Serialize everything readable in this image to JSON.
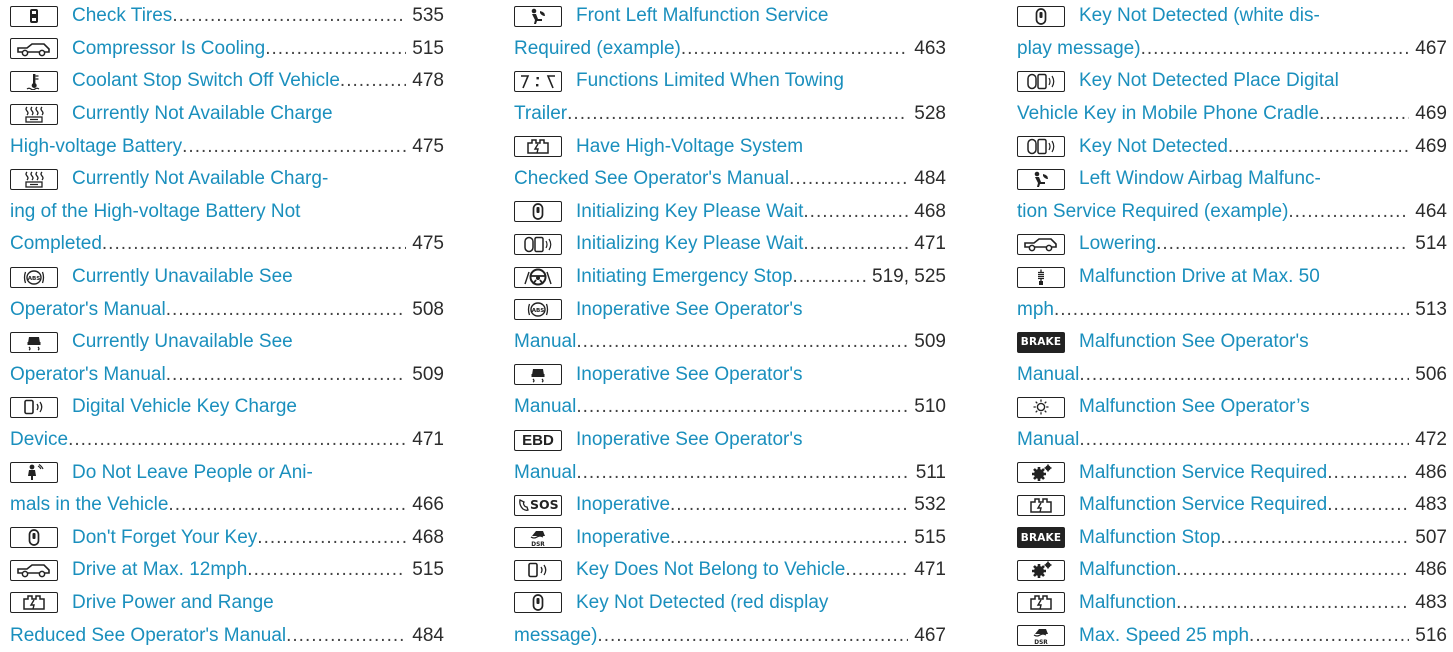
{
  "columns": [
    {
      "entries": [
        {
          "icon": "tire-pressure-icon",
          "lines": [
            "Check Tires"
          ],
          "page": "535"
        },
        {
          "icon": "car-level-icon",
          "lines": [
            "Compressor Is Cooling"
          ],
          "page": "515"
        },
        {
          "icon": "coolant-temperature-icon",
          "lines": [
            "Coolant Stop Switch Off Vehicle"
          ],
          "page": "478"
        },
        {
          "icon": "battery-heat-icon",
          "lines": [
            "Currently Not Available Charge",
            "High-voltage Battery"
          ],
          "page": "475"
        },
        {
          "icon": "battery-heat-icon",
          "lines": [
            "Currently Not Available Charg-",
            "ing of the High-voltage Battery Not",
            "Completed"
          ],
          "page": "475"
        },
        {
          "icon": "abs-icon",
          "icon_text": "ABS",
          "lines": [
            "Currently Unavailable See",
            "Operator's Manual"
          ],
          "page": "508"
        },
        {
          "icon": "skid-car-icon",
          "lines": [
            "Currently Unavailable See",
            "Operator's Manual"
          ],
          "page": "509"
        },
        {
          "icon": "phone-key-icon",
          "lines": [
            "Digital Vehicle Key Charge",
            "Device"
          ],
          "page": "471"
        },
        {
          "icon": "person-in-car-icon",
          "lines": [
            "Do Not Leave People or Ani-",
            "mals in the Vehicle"
          ],
          "page": "466"
        },
        {
          "icon": "key-fob-icon",
          "lines": [
            "Don't Forget Your Key"
          ],
          "page": "468"
        },
        {
          "icon": "car-level-icon",
          "lines": [
            "Drive at Max. 12mph"
          ],
          "page": "515"
        },
        {
          "icon": "hv-battery-icon",
          "lines": [
            "Drive Power and Range",
            "Reduced See Operator's Manual"
          ],
          "page": "484"
        }
      ]
    },
    {
      "entries": [
        {
          "icon": "airbag-icon",
          "lines": [
            "Front Left Malfunction Service",
            "Required (example)"
          ],
          "page": "463"
        },
        {
          "icon": "towing-lanes-icon",
          "lines": [
            "Functions Limited When Towing",
            "Trailer"
          ],
          "page": "528"
        },
        {
          "icon": "hv-battery-icon",
          "lines": [
            "Have High-Voltage System",
            "Checked See Operator's Manual"
          ],
          "page": "484"
        },
        {
          "icon": "key-fob-icon",
          "lines": [
            "Initializing Key Please Wait"
          ],
          "page": "468"
        },
        {
          "icon": "digital-key-icon",
          "lines": [
            "Initializing Key Please Wait"
          ],
          "page": "471"
        },
        {
          "icon": "steering-wheel-icon",
          "lines": [
            "Initiating Emergency Stop"
          ],
          "page": "519, 525"
        },
        {
          "icon": "abs-icon",
          "icon_text": "ABS",
          "lines": [
            "Inoperative See Operator's",
            "Manual"
          ],
          "page": "509"
        },
        {
          "icon": "skid-car-icon",
          "lines": [
            "Inoperative See Operator's",
            "Manual"
          ],
          "page": "510"
        },
        {
          "icon": "ebd-icon",
          "icon_text": "EBD",
          "lines": [
            "Inoperative See Operator's",
            "Manual"
          ],
          "page": "511"
        },
        {
          "icon": "sos-icon",
          "icon_text": "SOS",
          "lines": [
            "Inoperative"
          ],
          "page": "532"
        },
        {
          "icon": "dsr-icon",
          "icon_text": "DSR",
          "lines": [
            "Inoperative"
          ],
          "page": "515"
        },
        {
          "icon": "phone-key-icon",
          "lines": [
            "Key Does Not Belong to Vehicle"
          ],
          "page": "471"
        },
        {
          "icon": "key-fob-icon",
          "lines": [
            "Key Not Detected  (red display",
            "message)"
          ],
          "page": "467"
        }
      ]
    },
    {
      "entries": [
        {
          "icon": "key-fob-icon",
          "lines": [
            "Key Not Detected  (white dis-",
            "play message)"
          ],
          "page": "467"
        },
        {
          "icon": "digital-key-icon",
          "lines": [
            "Key Not Detected Place Digital",
            "Vehicle Key in Mobile Phone Cradle"
          ],
          "page": "469"
        },
        {
          "icon": "digital-key-icon",
          "lines": [
            "Key Not Detected"
          ],
          "page": "469"
        },
        {
          "icon": "airbag-icon",
          "lines": [
            "Left Window Airbag Malfunc-",
            "tion Service Required (example)"
          ],
          "page": "464"
        },
        {
          "icon": "car-level-icon",
          "lines": [
            "Lowering"
          ],
          "page": "514"
        },
        {
          "icon": "shock-absorber-icon",
          "lines": [
            "Malfunction Drive at Max. 50",
            "mph"
          ],
          "page": "513"
        },
        {
          "icon": "brake-icon",
          "icon_text": "BRAKE",
          "lines": [
            "Malfunction See Operator's",
            "Manual"
          ],
          "page": "506"
        },
        {
          "icon": "light-icon",
          "lines": [
            "Malfunction See Operator’s",
            "Manual"
          ],
          "page": "472"
        },
        {
          "icon": "gear-icon",
          "lines": [
            "Malfunction Service Required"
          ],
          "page": "486"
        },
        {
          "icon": "hv-battery-icon",
          "lines": [
            "Malfunction Service Required"
          ],
          "page": "483"
        },
        {
          "icon": "brake-icon",
          "icon_text": "BRAKE",
          "lines": [
            "Malfunction Stop"
          ],
          "page": "507"
        },
        {
          "icon": "gear-icon",
          "lines": [
            "Malfunction"
          ],
          "page": "486"
        },
        {
          "icon": "hv-battery-icon",
          "lines": [
            "Malfunction"
          ],
          "page": "483"
        },
        {
          "icon": "dsr-icon",
          "icon_text": "DSR",
          "lines": [
            "Max. Speed 25 mph"
          ],
          "page": "516"
        }
      ]
    }
  ]
}
